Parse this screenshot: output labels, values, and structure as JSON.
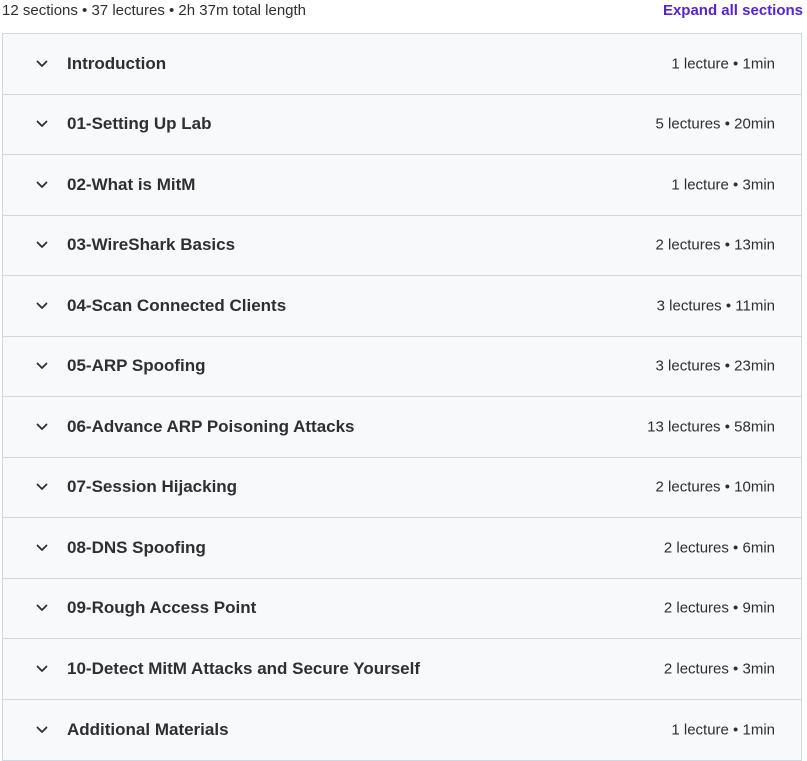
{
  "header": {
    "summary": "12 sections • 37 lectures • 2h 37m total length",
    "expand_all": "Expand all sections"
  },
  "sections": [
    {
      "title": "Introduction",
      "meta": "1 lecture • 1min"
    },
    {
      "title": "01-Setting Up Lab",
      "meta": "5 lectures • 20min"
    },
    {
      "title": "02-What is MitM",
      "meta": "1 lecture • 3min"
    },
    {
      "title": "03-WireShark Basics",
      "meta": "2 lectures • 13min"
    },
    {
      "title": "04-Scan Connected Clients",
      "meta": "3 lectures • 11min"
    },
    {
      "title": "05-ARP Spoofing",
      "meta": "3 lectures • 23min"
    },
    {
      "title": "06-Advance ARP Poisoning Attacks",
      "meta": "13 lectures • 58min"
    },
    {
      "title": "07-Session Hijacking",
      "meta": "2 lectures • 10min"
    },
    {
      "title": "08-DNS Spoofing",
      "meta": "2 lectures • 6min"
    },
    {
      "title": "09-Rough Access Point",
      "meta": "2 lectures • 9min"
    },
    {
      "title": "10-Detect MitM Attacks and Secure Yourself",
      "meta": "2 lectures • 3min"
    },
    {
      "title": "Additional Materials",
      "meta": "1 lecture • 1min"
    }
  ],
  "icons": {
    "expand": "chevron-down-icon"
  },
  "colors": {
    "accent": "#5624d0",
    "row_bg": "#f7f9fa",
    "border": "#d1d7dc",
    "text": "#2d2f31"
  }
}
